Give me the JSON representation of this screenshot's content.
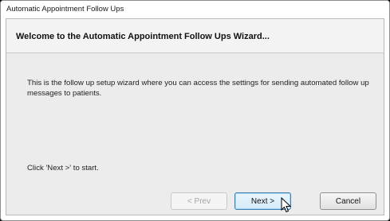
{
  "window": {
    "title": "Automatic Appointment Follow Ups"
  },
  "wizard": {
    "header_title": "Welcome to the Automatic Appointment Follow Ups Wizard...",
    "description": "This is the follow up setup wizard where you can access the settings for sending automated follow up messages to patients.",
    "start_hint": "Click 'Next >' to start."
  },
  "buttons": {
    "prev_label": "< Prev",
    "next_label": "Next >",
    "cancel_label": "Cancel"
  },
  "states": {
    "prev_enabled": false,
    "next_focused": true
  },
  "icons": {
    "cursor": "mouse-pointer-icon"
  },
  "colors": {
    "focus_border": "#3c7fb1",
    "disabled_text": "#a5a5a5"
  }
}
